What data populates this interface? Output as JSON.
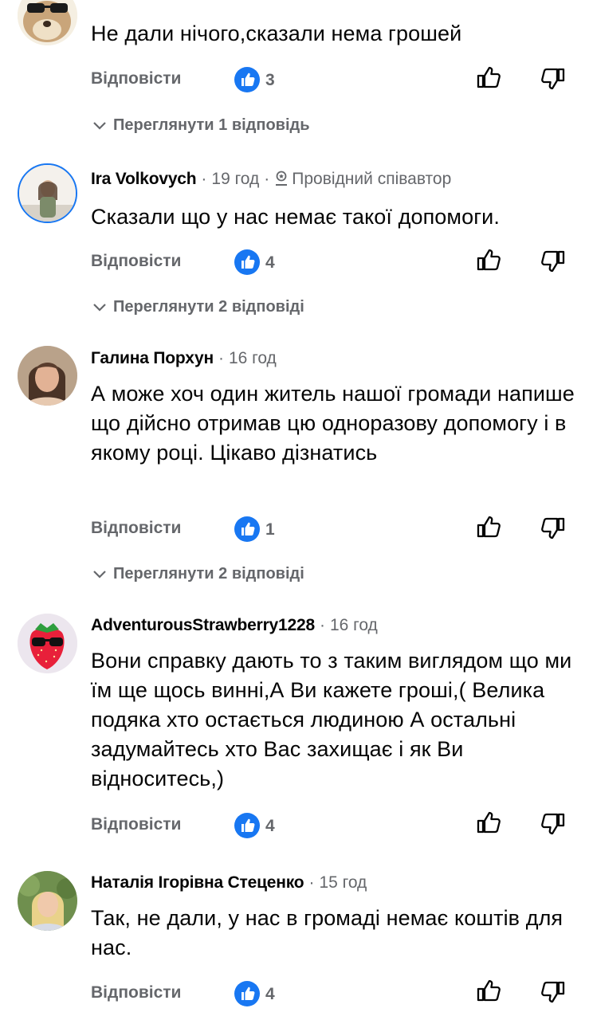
{
  "labels": {
    "reply": "Відповісти"
  },
  "comments": [
    {
      "author": "",
      "time": "",
      "text": "Не дали нічого,сказали нема грошей",
      "likes": "3",
      "view_replies": "Переглянути 1 відповідь",
      "avatar_icon": "cartoon-dog-sunglasses-avatar"
    },
    {
      "author": "Ira Volkovych",
      "time": "19 год",
      "badge": "Провідний співавтор",
      "text": "Сказали що у нас немає такої допомоги.",
      "likes": "4",
      "view_replies": "Переглянути 2 відповіді",
      "avatar_icon": "photo-avatar"
    },
    {
      "author": "Галина Порхун",
      "time": "16 год",
      "text": "А може хоч один житель нашої громади напише що дійсно отримав цю одноразову допомогу і в якому році. Цікаво дізнатись",
      "likes": "1",
      "view_replies": "Переглянути 2 відповіді",
      "avatar_icon": "photo-avatar"
    },
    {
      "author": "AdventurousStrawberry1228",
      "time": "16 год",
      "text": "Вони справку дають то з таким виглядом що ми їм ще щось винні,А Ви кажете гроші,( Велика подяка хто остається людиною А остальні задумайтесь хто Вас захищає і як Ви відноситесь,)",
      "likes": "4",
      "avatar_icon": "strawberry-sunglasses-avatar"
    },
    {
      "author": "Наталія Ігорівна Стеценко",
      "time": "15 год",
      "text": "Так, не дали, у нас в громаді немає коштів для нас.",
      "likes": "4",
      "avatar_icon": "photo-avatar"
    }
  ],
  "colors": {
    "like_blue": "#1877f2",
    "meta_gray": "#65676b",
    "text": "#050505"
  }
}
